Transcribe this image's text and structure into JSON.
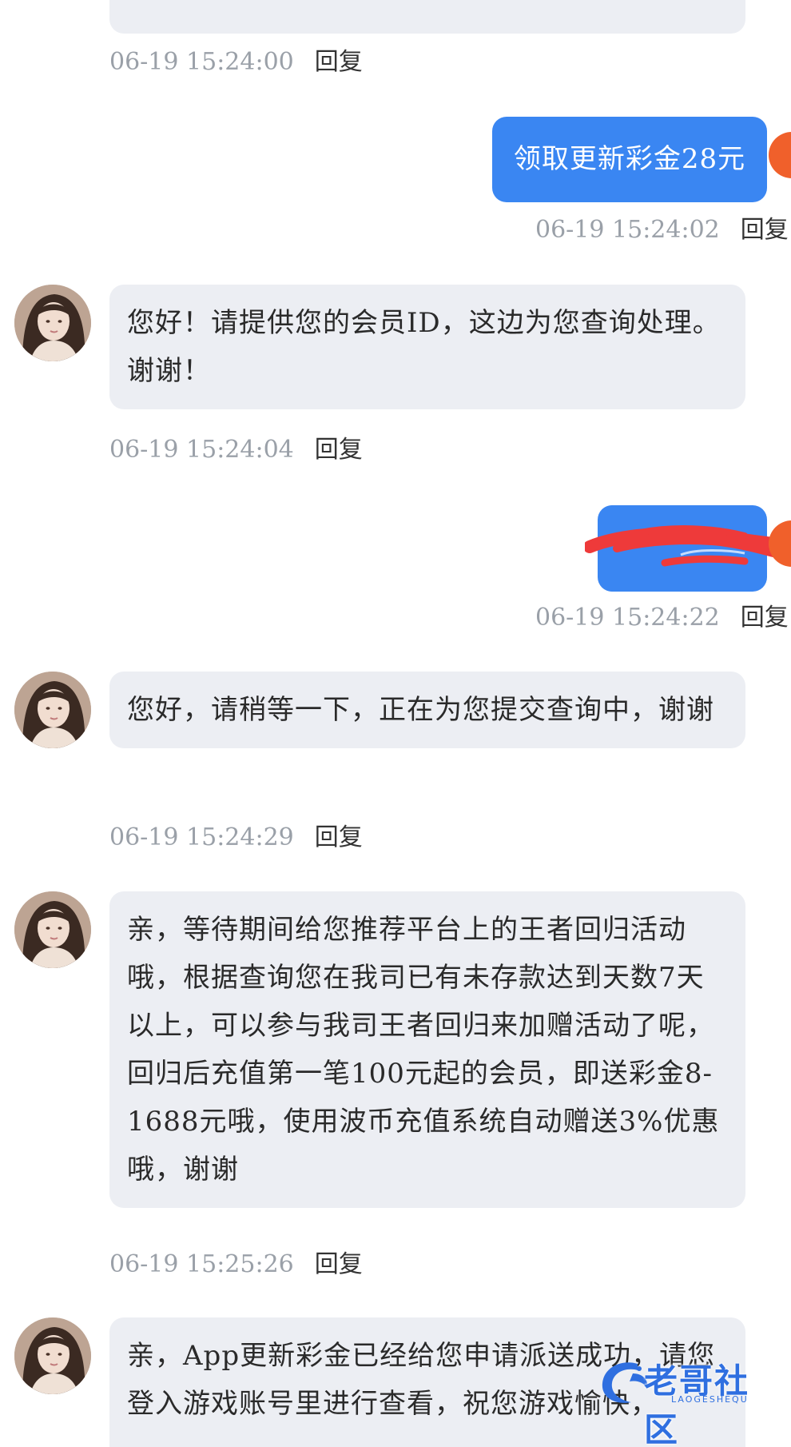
{
  "messages": [
    {
      "id": "m0",
      "direction": "incoming",
      "text": "",
      "time": "06-19 15:24:00",
      "reply_label": "回复"
    },
    {
      "id": "m1",
      "direction": "outgoing",
      "text": "领取更新彩金28元",
      "time": "06-19 15:24:02",
      "reply_label": "回复"
    },
    {
      "id": "m2",
      "direction": "incoming",
      "text": "您好！请提供您的会员ID，这边为您查询处理。谢谢！",
      "time": "06-19 15:24:04",
      "reply_label": "回复"
    },
    {
      "id": "m3",
      "direction": "outgoing",
      "text": "",
      "redacted": true,
      "time": "06-19 15:24:22",
      "reply_label": "回复"
    },
    {
      "id": "m4",
      "direction": "incoming",
      "text": "您好，请稍等一下，正在为您提交查询中，谢谢",
      "time": "06-19 15:24:29",
      "reply_label": "回复"
    },
    {
      "id": "m5",
      "direction": "incoming",
      "text": "亲，等待期间给您推荐平台上的王者回归活动哦，根据查询您在我司已有未存款达到天数7天以上，可以参与我司王者回归来加赠活动了呢，回归后充值第一笔100元起的会员，即送彩金8-1688元哦，使用波币充值系统自动赠送3%优惠哦，谢谢",
      "time": "06-19 15:25:26",
      "reply_label": "回复"
    },
    {
      "id": "m6",
      "direction": "incoming",
      "text": "亲，App更新彩金已经给您申请派送成功，请您登入游戏账号里进行查看，祝您游戏愉快，",
      "time": "",
      "reply_label": ""
    }
  ],
  "watermark": {
    "text": "老哥社区",
    "sub": "LAOGESHEQU",
    "color": "#2f6fe0"
  },
  "colors": {
    "outgoing_bubble": "#3a86f2",
    "incoming_bubble": "#eceef3",
    "redaction": "#ee3a3a",
    "self_avatar": "#f0602b"
  }
}
